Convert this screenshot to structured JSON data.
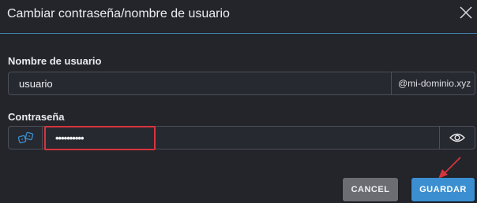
{
  "dialog": {
    "title": "Cambiar contraseña/nombre de usuario",
    "close_icon": "close-icon"
  },
  "username": {
    "label": "Nombre de usuario",
    "value": "usuario",
    "domain_suffix": "@mi-dominio.xyz"
  },
  "password": {
    "label": "Contraseña",
    "value": "••••••••••",
    "generate_icon": "dice-icon",
    "visibility_icon": "eye-icon"
  },
  "actions": {
    "cancel_label": "CANCEL",
    "save_label": "GUARDAR"
  },
  "colors": {
    "background": "#23252b",
    "accent": "#3b8fd1",
    "highlight": "#d6343d"
  }
}
